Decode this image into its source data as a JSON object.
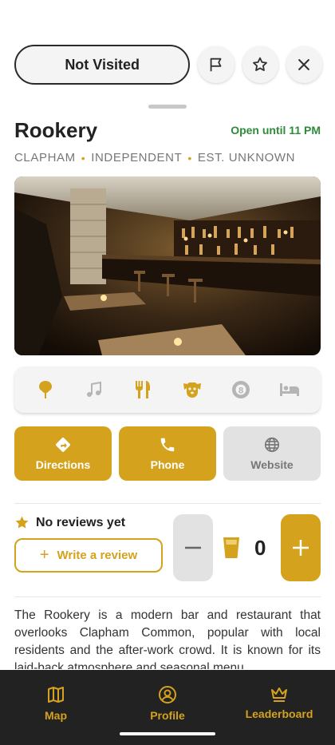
{
  "top_bar": {
    "visit_status": "Not Visited",
    "icons": [
      "flag-icon",
      "star-icon",
      "close-icon"
    ]
  },
  "venue": {
    "name": "Rookery",
    "open_status": "Open until 11 PM",
    "area": "CLAPHAM",
    "ownership": "INDEPENDENT",
    "established": "EST. UNKNOWN"
  },
  "amenities": [
    {
      "icon": "tree-icon",
      "active": true
    },
    {
      "icon": "music-icon",
      "active": false
    },
    {
      "icon": "food-icon",
      "active": true
    },
    {
      "icon": "dog-icon",
      "active": true
    },
    {
      "icon": "pool-ball-icon",
      "active": false
    },
    {
      "icon": "bed-icon",
      "active": false
    }
  ],
  "actions": {
    "directions": "Directions",
    "phone": "Phone",
    "website": "Website"
  },
  "reviews": {
    "status": "No reviews yet",
    "write_label": "Write a review"
  },
  "pint_counter": {
    "count": "0"
  },
  "description": "The Rookery is a modern bar and restaurant that overlooks Clapham Common, popular with local residents and the after-work crowd. It is known for its laid-back atmosphere and seasonal menu.",
  "nav": {
    "map": "Map",
    "profile": "Profile",
    "leaderboard": "Leaderboard"
  },
  "colors": {
    "accent": "#d4a21c",
    "open_green": "#2e8b3a",
    "nav_bg": "#222222",
    "inactive_icon": "#b5b5b5"
  }
}
